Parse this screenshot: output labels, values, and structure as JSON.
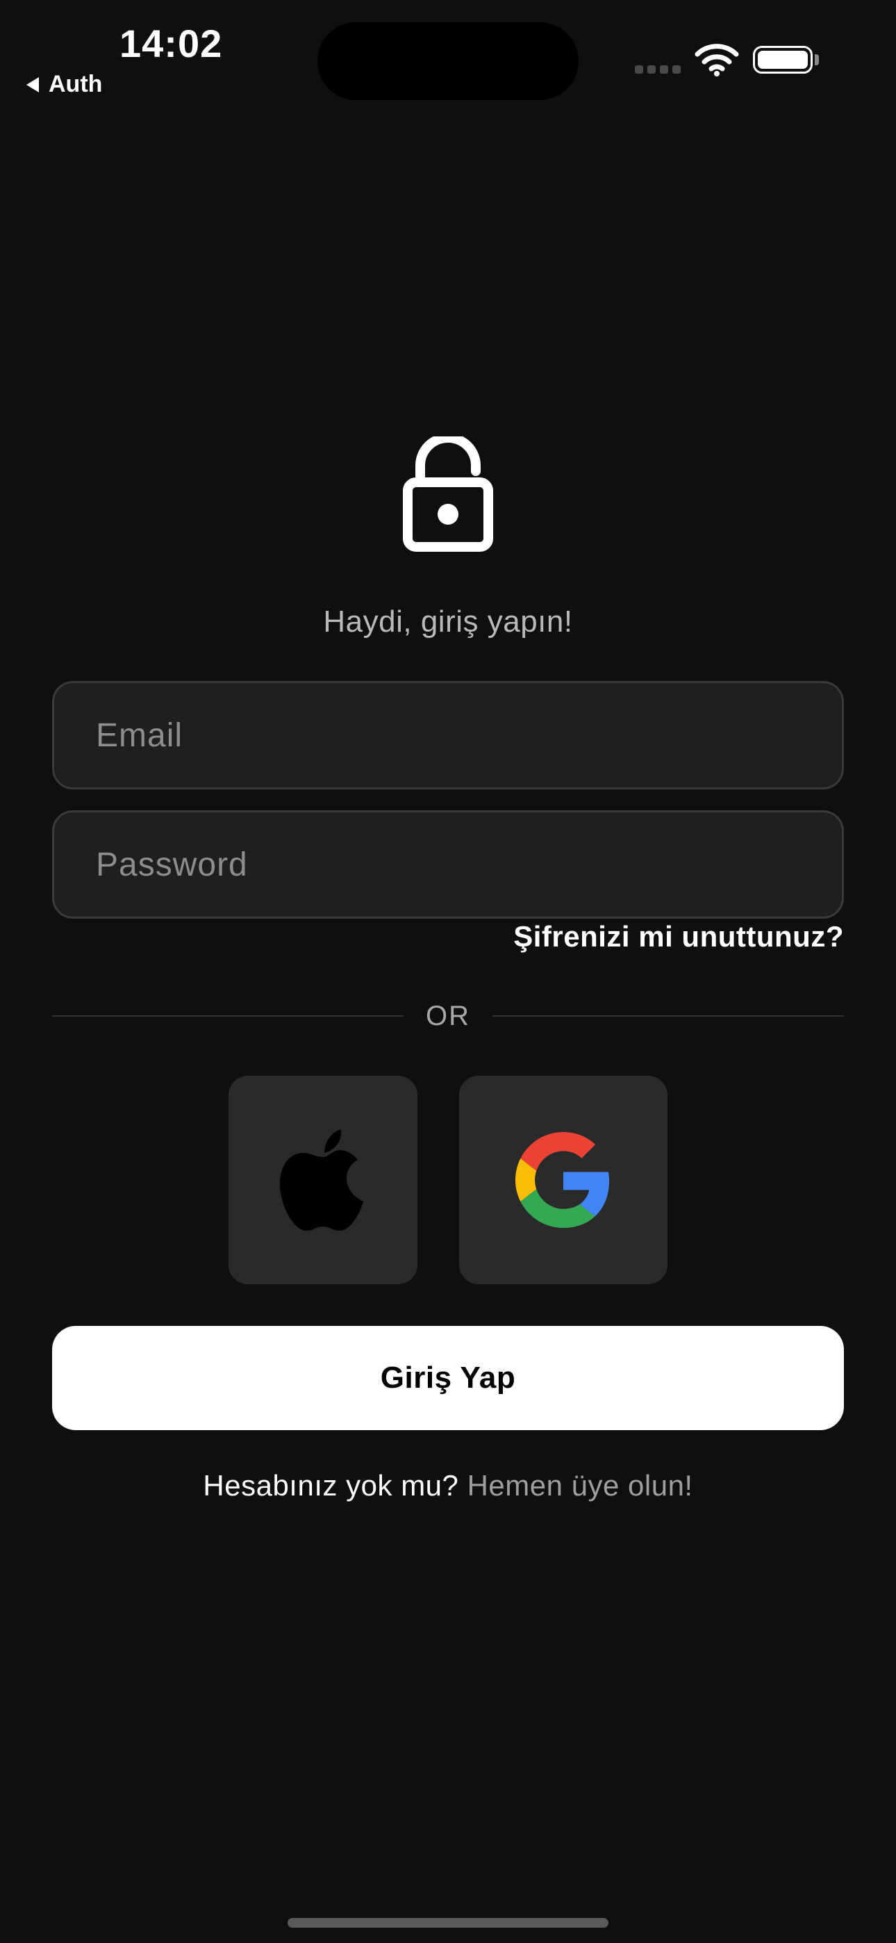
{
  "status_bar": {
    "time": "14:02",
    "back_label": "Auth"
  },
  "login": {
    "subtitle": "Haydi, giriş yapın!",
    "email_placeholder": "Email",
    "password_placeholder": "Password",
    "forgot_password": "Şifrenizi mi unuttunuz?",
    "divider_text": "OR",
    "submit_label": "Giriş Yap",
    "signup_prompt": "Hesabınız yok mu?",
    "signup_link": "Hemen üye olun!"
  },
  "social": [
    {
      "provider": "apple",
      "icon": "apple-logo-icon"
    },
    {
      "provider": "google",
      "icon": "google-logo-icon"
    }
  ],
  "colors": {
    "background": "#0f0f0f",
    "input_background": "#1f1f1f",
    "input_border": "#3a3a3a",
    "social_button_background": "#2a2a2a",
    "primary_button_background": "#ffffff",
    "primary_button_text": "#000000",
    "muted_text": "#b9b9b9"
  }
}
